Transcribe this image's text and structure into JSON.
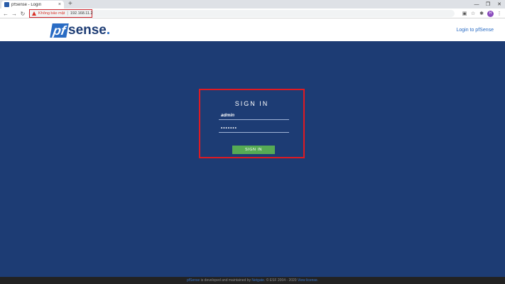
{
  "browser": {
    "tab_title": "pfSense - Login",
    "tab_close": "×",
    "new_tab": "+",
    "security_label": "Không bảo mật",
    "separator": "|",
    "url": "192.168.11.2",
    "profile_initial": "H"
  },
  "header": {
    "logo_pf": "pf",
    "logo_sense": "sense",
    "logo_dot": ".",
    "login_link": "Login to pfSense"
  },
  "login": {
    "title": "SIGN IN",
    "username_value": "admin",
    "password_value": "•••••••",
    "submit_label": "SIGN IN"
  },
  "footer": {
    "brand": "pfSense",
    "text1": " is developed and maintained by ",
    "company": "Netgate",
    "text2": ". © ESF 2004 - 2020 ",
    "license": "View license."
  },
  "colors": {
    "background": "#1d3c74",
    "accent": "#2a6cc4",
    "button": "#56ab54",
    "highlight": "#e01a22"
  }
}
